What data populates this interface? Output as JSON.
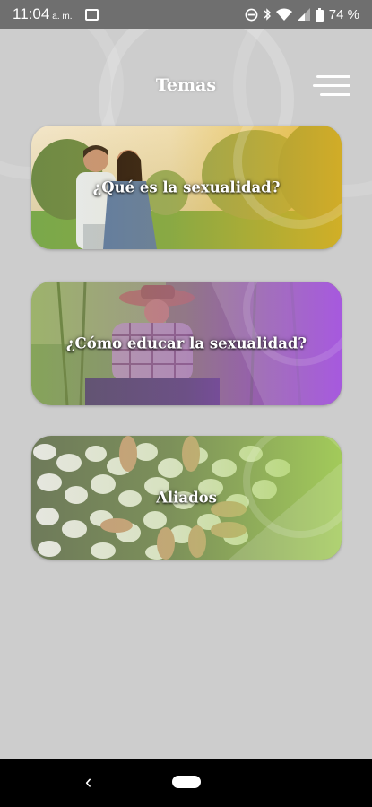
{
  "status_bar": {
    "time": "11:04",
    "ampm": "a. m.",
    "battery": "74 %",
    "icons": [
      "notification-icon",
      "do-not-disturb-icon",
      "bluetooth-icon",
      "wifi-icon",
      "signal-icon",
      "battery-icon"
    ]
  },
  "header": {
    "title": "Temas",
    "menu_icon": "hamburger-menu-icon"
  },
  "cards": [
    {
      "label": "¿Qué es la sexualidad?",
      "accent": "#e0b020"
    },
    {
      "label": "¿Cómo educar la sexualidad?",
      "accent": "#9b3fe0"
    },
    {
      "label": "Aliados",
      "accent": "#a8d35a"
    }
  ],
  "nav_bar": {
    "back_icon": "back-chevron-icon",
    "home_icon": "home-pill-icon"
  }
}
